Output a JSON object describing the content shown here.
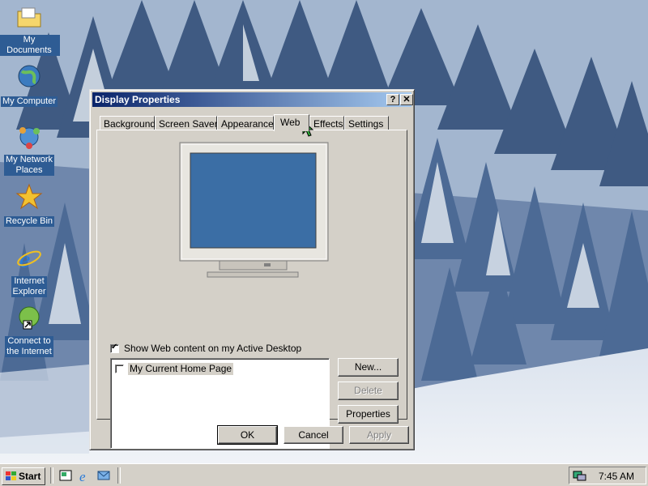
{
  "desktop": {
    "icons": [
      {
        "label": "My Documents",
        "icon": "folder-icon"
      },
      {
        "label": "My Computer",
        "icon": "computer-icon"
      },
      {
        "label": "My Network Places",
        "label_line1": "My Network",
        "label_line2": "Places",
        "icon": "network-icon"
      },
      {
        "label": "Recycle Bin",
        "icon": "recycle-bin-icon"
      },
      {
        "label": "Internet Explorer",
        "label_line1": "Internet",
        "label_line2": "Explorer",
        "icon": "ie-icon"
      },
      {
        "label": "Connect to the Internet",
        "label_line1": "Connect to",
        "label_line2": "the Internet",
        "icon": "connect-icon"
      }
    ]
  },
  "window": {
    "title": "Display Properties",
    "help_label": "?",
    "close_label": "✕",
    "tabs": [
      {
        "label": "Background"
      },
      {
        "label": "Screen Saver"
      },
      {
        "label": "Appearance"
      },
      {
        "label": "Web",
        "active": true
      },
      {
        "label": "Effects"
      },
      {
        "label": "Settings"
      }
    ],
    "web": {
      "show_web_content_label": "Show Web content on my Active Desktop",
      "show_web_content_checked": true,
      "items": [
        {
          "label": "My Current Home Page",
          "checked": false
        }
      ],
      "buttons": {
        "new": "New...",
        "delete": "Delete",
        "properties": "Properties"
      }
    },
    "footer": {
      "ok": "OK",
      "cancel": "Cancel",
      "apply": "Apply"
    }
  },
  "taskbar": {
    "start_label": "Start",
    "clock": "7:45 AM"
  },
  "colors": {
    "title_active_start": "#0a246a",
    "title_active_end": "#a6caf0",
    "face": "#d4d0c8",
    "monitor_screen": "#3b6ea5"
  }
}
